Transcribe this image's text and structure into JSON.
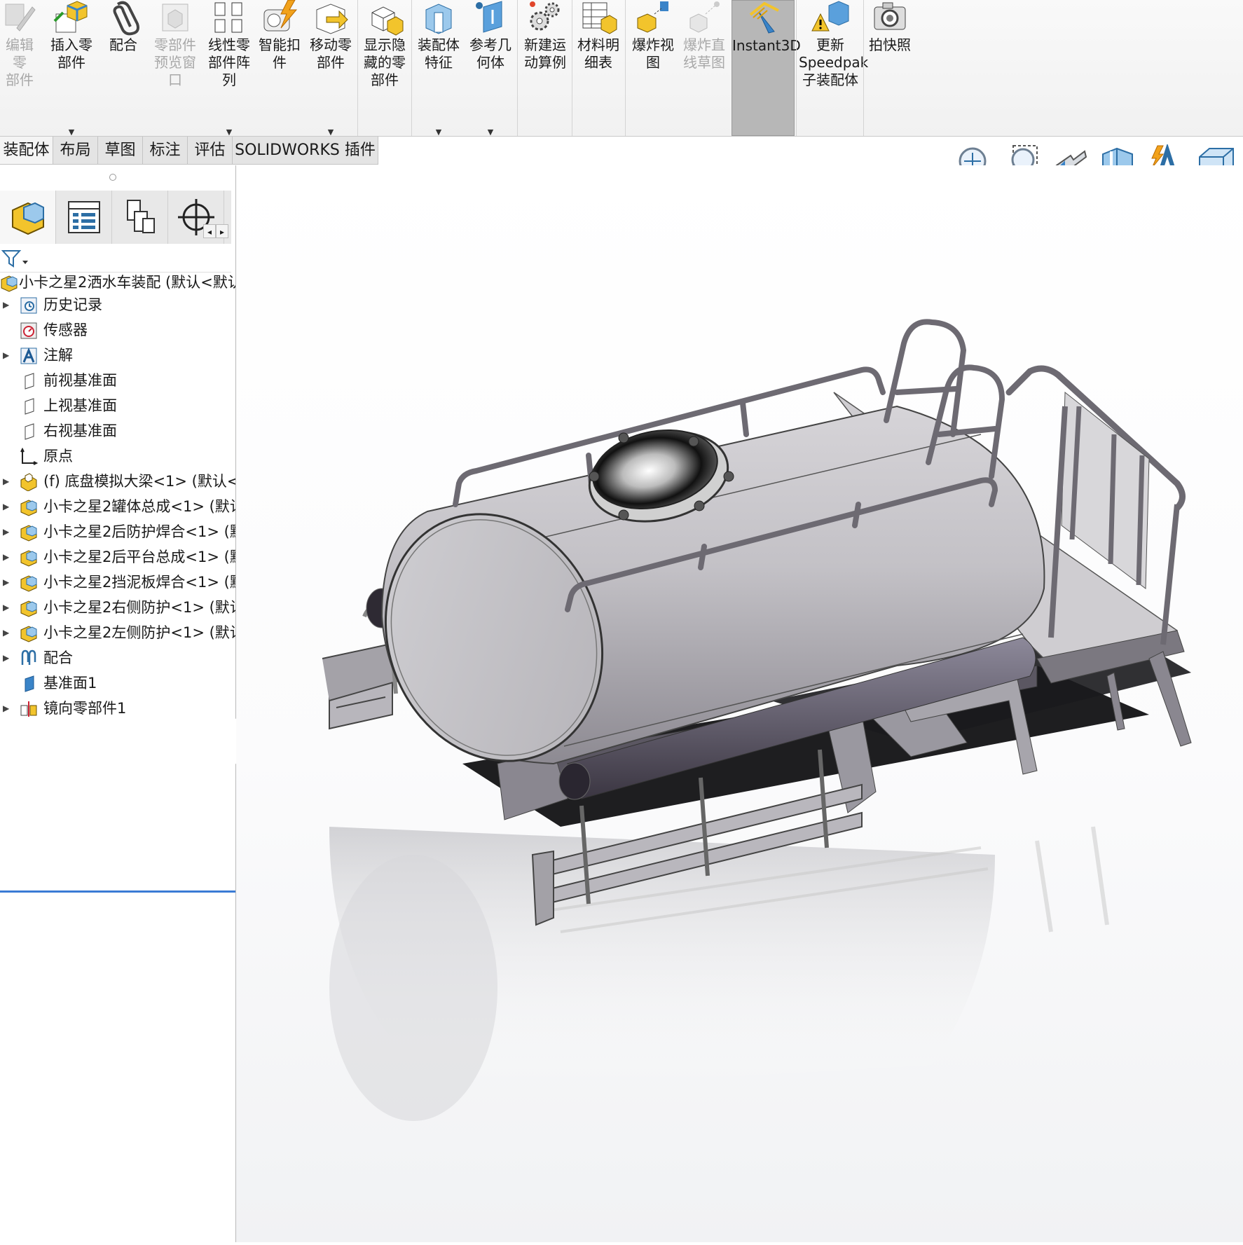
{
  "ribbon": {
    "tools": [
      {
        "id": "edit-part",
        "label": "编辑零\n部件",
        "disabled": true
      },
      {
        "id": "insert-component",
        "label": "插入零\n部件",
        "dropdown": true
      },
      {
        "id": "mate",
        "label": "配合"
      },
      {
        "id": "component-preview",
        "label": "零部件\n预览窗\n口",
        "disabled": true
      },
      {
        "id": "linear-pattern",
        "label": "线性零\n部件阵\n列",
        "dropdown": true
      },
      {
        "id": "smart-fasteners",
        "label": "智能扣\n件"
      },
      {
        "id": "move-component",
        "label": "移动零\n部件",
        "dropdown": true
      },
      {
        "id": "show-hidden",
        "label": "显示隐\n藏的零\n部件"
      },
      {
        "id": "assembly-features",
        "label": "装配体\n特征",
        "dropdown": true
      },
      {
        "id": "reference-geometry",
        "label": "参考几\n何体",
        "dropdown": true
      },
      {
        "id": "new-motion-study",
        "label": "新建运\n动算例"
      },
      {
        "id": "bill-of-materials",
        "label": "材料明\n细表"
      },
      {
        "id": "exploded-view",
        "label": "爆炸视\n图"
      },
      {
        "id": "explode-line-sketch",
        "label": "爆炸直\n线草图",
        "disabled": true
      },
      {
        "id": "instant3d",
        "label": "Instant3D",
        "active": true
      },
      {
        "id": "update-speedpak",
        "label": "更新\nSpeedpak\n子装配体"
      },
      {
        "id": "take-snapshot",
        "label": "拍快照"
      }
    ]
  },
  "tabs": [
    "装配体",
    "布局",
    "草图",
    "标注",
    "评估",
    "SOLIDWORKS 插件"
  ],
  "tree": {
    "root": "小卡之星2洒水车装配 (默认<默认",
    "items": [
      {
        "label": "历史记录",
        "icon": "history-icon",
        "expand": true
      },
      {
        "label": "传感器",
        "icon": "sensor-icon",
        "expand": false
      },
      {
        "label": "注解",
        "icon": "annotation-icon",
        "expand": true
      },
      {
        "label": "前视基准面",
        "icon": "plane-icon",
        "expand": false
      },
      {
        "label": "上视基准面",
        "icon": "plane-icon",
        "expand": false
      },
      {
        "label": "右视基准面",
        "icon": "plane-icon",
        "expand": false
      },
      {
        "label": "原点",
        "icon": "origin-icon",
        "expand": false
      },
      {
        "label": "(f) 底盘模拟大梁<1> (默认<-",
        "icon": "part-icon",
        "expand": true
      },
      {
        "label": "小卡之星2罐体总成<1> (默认",
        "icon": "subassembly-icon",
        "expand": true
      },
      {
        "label": "小卡之星2后防护焊合<1> (默",
        "icon": "subassembly-icon",
        "expand": true
      },
      {
        "label": "小卡之星2后平台总成<1> (默",
        "icon": "subassembly-icon",
        "expand": true
      },
      {
        "label": "小卡之星2挡泥板焊合<1> (默",
        "icon": "subassembly-icon",
        "expand": true
      },
      {
        "label": "小卡之星2右侧防护<1> (默认",
        "icon": "subassembly-icon",
        "expand": true
      },
      {
        "label": "小卡之星2左侧防护<1> (默认",
        "icon": "subassembly-icon",
        "expand": true
      },
      {
        "label": "配合",
        "icon": "mates-icon",
        "expand": true
      },
      {
        "label": "基准面1",
        "icon": "plane-icon",
        "expand": false
      },
      {
        "label": "镜向零部件1",
        "icon": "mirror-component-icon",
        "expand": true
      }
    ]
  },
  "hud_tools": [
    "zoom-to-fit-icon",
    "zoom-to-area-icon",
    "previous-view-icon",
    "section-view-icon",
    "dynamic-annotation-views-icon",
    "view-orientation-icon"
  ],
  "colors": {
    "accent": "#3a7bd5",
    "active_tool": "#b7b7b7",
    "part_yellow": "#f2c42c"
  }
}
